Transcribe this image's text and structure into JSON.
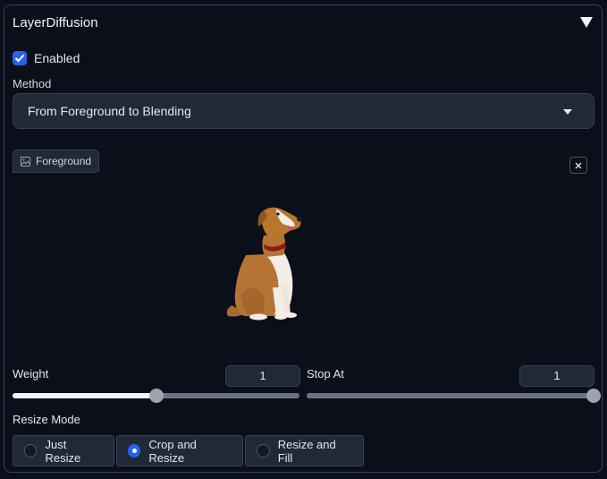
{
  "panel": {
    "title": "LayerDiffusion",
    "collapse_icon": "triangle-down-icon"
  },
  "enabled": {
    "label": "Enabled",
    "checked": true
  },
  "method": {
    "label": "Method",
    "value": "From Foreground to Blending"
  },
  "image_input": {
    "tab_label": "Foreground",
    "tab_icon": "image-icon",
    "clear_icon": "close-icon",
    "image_description": "dog-photo"
  },
  "weight": {
    "label": "Weight",
    "value": "1",
    "fraction": 0.5
  },
  "stop_at": {
    "label": "Stop At",
    "value": "1",
    "fraction": 1.0
  },
  "resize_mode": {
    "label": "Resize Mode",
    "options": [
      {
        "label": "Just Resize",
        "selected": false
      },
      {
        "label": "Crop and Resize",
        "selected": true
      },
      {
        "label": "Resize and Fill",
        "selected": false
      }
    ]
  },
  "colors": {
    "accent": "#2563eb",
    "background": "#0b0f19",
    "surface": "#1f2937",
    "border": "#374151"
  }
}
